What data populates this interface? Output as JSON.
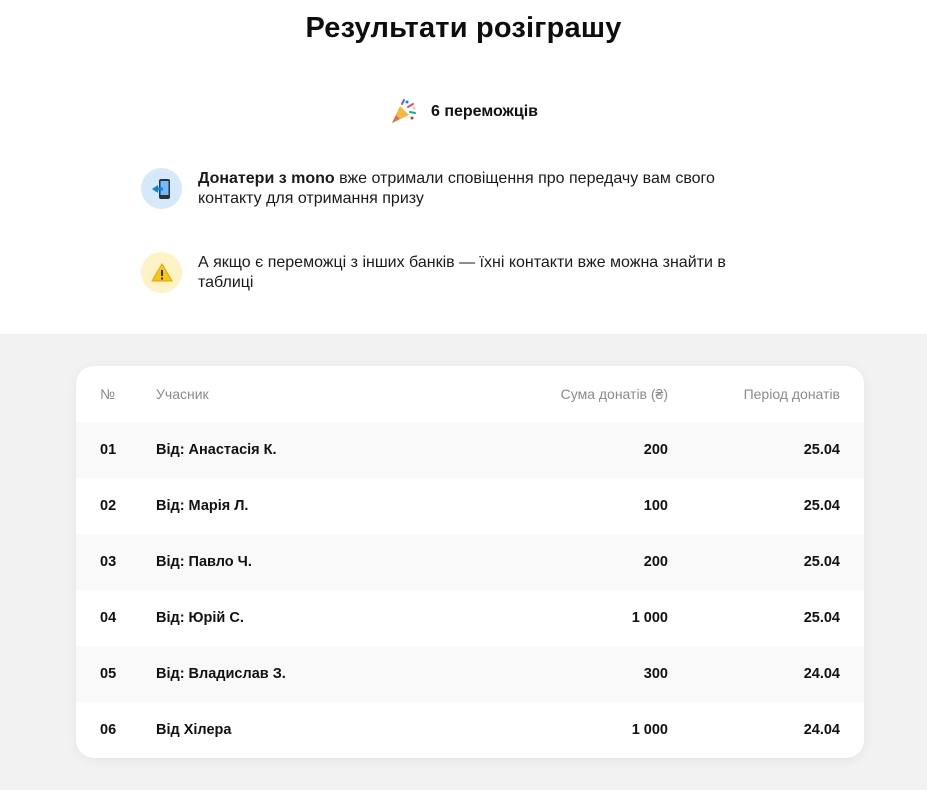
{
  "page": {
    "title": "Результати розіграшу",
    "winners_count_label": "6 переможців"
  },
  "info": [
    {
      "icon": "phone-arrow-icon",
      "bold": "Донатери з mono",
      "text": " вже отримали сповіщення про передачу вам свого контакту для отримання призу"
    },
    {
      "icon": "warning-icon",
      "text": "А якщо є переможці з інших банків — їхні контакти вже можна знайти в таблиці"
    }
  ],
  "table": {
    "headers": {
      "num": "№",
      "participant": "Учасник",
      "sum": "Сума донатів (₴)",
      "period": "Період донатів"
    },
    "rows": [
      {
        "num": "01",
        "participant": "Від: Анастасія К.",
        "sum": "200",
        "period": "25.04"
      },
      {
        "num": "02",
        "participant": "Від: Марія Л.",
        "sum": "100",
        "period": "25.04"
      },
      {
        "num": "03",
        "participant": "Від: Павло Ч.",
        "sum": "200",
        "period": "25.04"
      },
      {
        "num": "04",
        "participant": "Від: Юрій С.",
        "sum": "1 000",
        "period": "25.04"
      },
      {
        "num": "05",
        "participant": "Від: Владислав З.",
        "sum": "300",
        "period": "24.04"
      },
      {
        "num": "06",
        "participant": "Від Хілера",
        "sum": "1 000",
        "period": "24.04"
      }
    ]
  },
  "colors": {
    "background_bottom": "#f2f2f2",
    "blue_badge": "#d6e9fb",
    "yellow_badge": "#fdf3c6",
    "header_text": "#8a8a8a"
  }
}
